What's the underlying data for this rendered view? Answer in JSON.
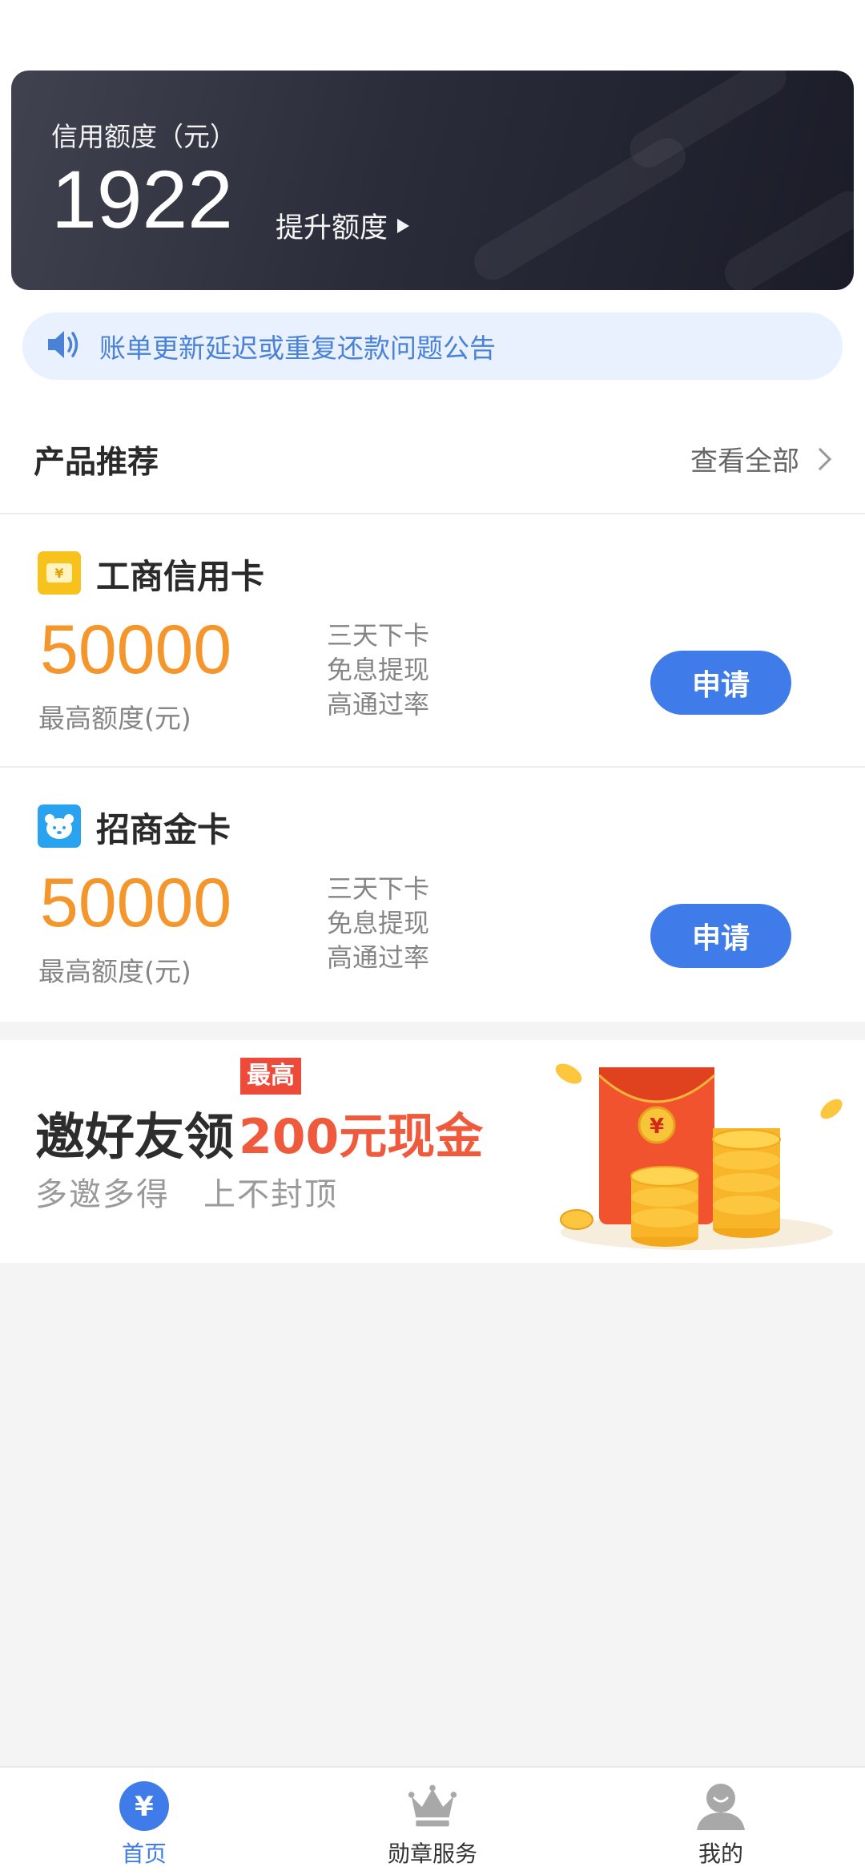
{
  "credit": {
    "title": "信用额度（元）",
    "amount": "1922",
    "raise_label": "提升额度"
  },
  "notice": {
    "text": "账单更新延迟或重复还款问题公告"
  },
  "products_section": {
    "title": "产品推荐",
    "view_all": "查看全部"
  },
  "products": [
    {
      "name": "工商信用卡",
      "amount": "50000",
      "amount_label": "最高额度(元)",
      "features": [
        "三天下卡",
        "免息提现",
        "高通过率"
      ],
      "apply_label": "申请",
      "icon": "yuan-card-icon",
      "icon_color": "#f7c21b"
    },
    {
      "name": "招商金卡",
      "amount": "50000",
      "amount_label": "最高额度(元)",
      "features": [
        "三天下卡",
        "免息提现",
        "高通过率"
      ],
      "apply_label": "申请",
      "icon": "bear-face-icon",
      "icon_color": "#29a3f0"
    }
  ],
  "banner": {
    "title": "邀好友领",
    "highlight": "200元现金",
    "badge": "最高",
    "subtitle": "多邀多得　上不封顶",
    "image_icon": "red-envelope-coins-icon"
  },
  "bottom_nav": {
    "items": [
      {
        "label": "首页",
        "icon": "yuan-circle-icon",
        "active": true
      },
      {
        "label": "勋章服务",
        "icon": "crown-icon",
        "active": false
      },
      {
        "label": "我的",
        "icon": "user-avatar-icon",
        "active": false
      }
    ]
  },
  "colors": {
    "accent": "#3f7ce9",
    "amount": "#f5962c",
    "promo_red": "#ef5a3c",
    "notice_bg": "#e8f1fd"
  }
}
